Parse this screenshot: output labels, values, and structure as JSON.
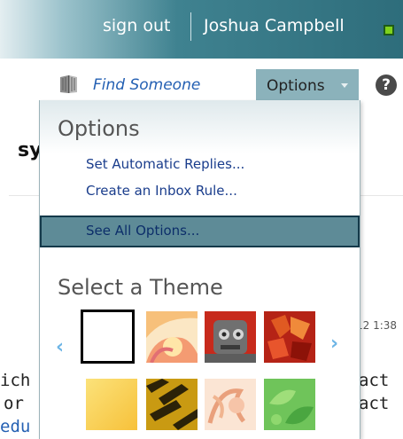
{
  "header": {
    "sign_out": "sign out",
    "user_name": "Joshua Campbell",
    "presence_color": "#7fd21c"
  },
  "toolbar": {
    "find_someone": "Find Someone",
    "options": "Options",
    "help_glyph": "?"
  },
  "background": {
    "title_fragment": "sy",
    "timestamp_fragment": "12 1:38",
    "lines": [
      "ich",
      "or",
      "edu",
      "act",
      "act"
    ]
  },
  "menu": {
    "heading": "Options",
    "items": [
      {
        "label": "Set Automatic Replies..."
      },
      {
        "label": "Create an Inbox Rule..."
      }
    ],
    "selected_item": "See All Options...",
    "theme_heading": "Select a Theme",
    "themes": [
      {
        "name": "blank",
        "selected": true
      },
      {
        "name": "sunrise"
      },
      {
        "name": "robot"
      },
      {
        "name": "autumn-leaves"
      },
      {
        "name": "yellow-gradient"
      },
      {
        "name": "tiger"
      },
      {
        "name": "peach-floral"
      },
      {
        "name": "green-leaves"
      }
    ]
  }
}
